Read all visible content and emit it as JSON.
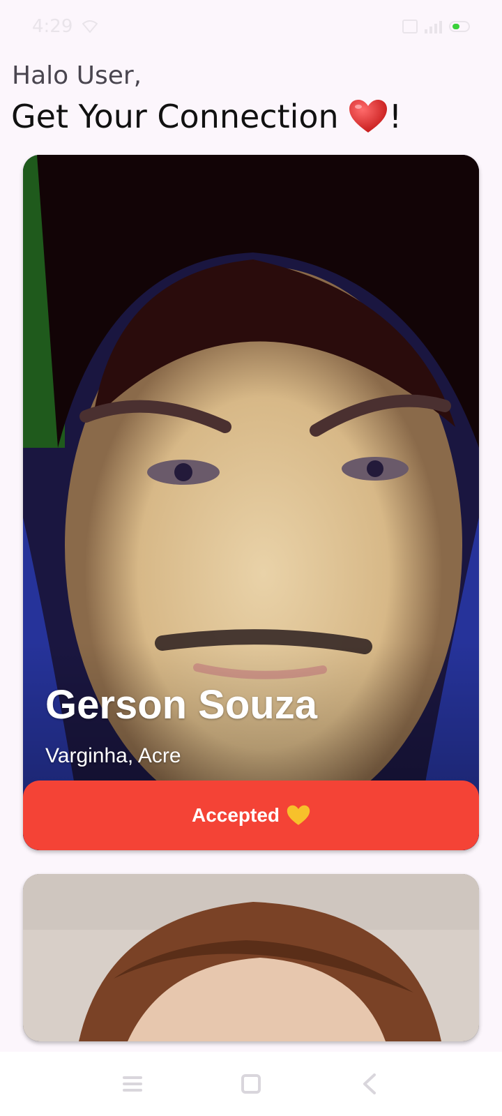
{
  "status_bar": {
    "time": "4:29"
  },
  "header": {
    "greeting": "Halo User,",
    "title_text": "Get Your Connection",
    "title_suffix": "!",
    "title_emoji": "red-heart-icon"
  },
  "cards": [
    {
      "name": "Gerson Souza",
      "location": "Varginha, Acre",
      "button_label": "Accepted",
      "button_emoji": "yellow-heart-icon"
    }
  ],
  "colors": {
    "accent": "#f44336",
    "background": "#fcf6fc"
  },
  "nav": {
    "icons": [
      "menu-icon",
      "home-icon",
      "back-icon"
    ]
  }
}
